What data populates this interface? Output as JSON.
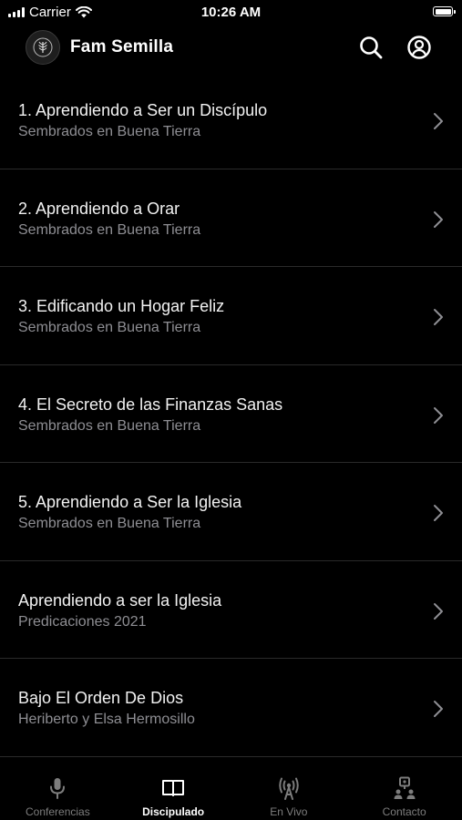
{
  "status_bar": {
    "carrier": "Carrier",
    "time": "10:26 AM"
  },
  "header": {
    "title": "Fam Semilla",
    "logo_icon": "wheat-seal-icon",
    "search_icon": "search-icon",
    "profile_icon": "profile-circle-icon"
  },
  "items": [
    {
      "title": "1. Aprendiendo a Ser un Discípulo",
      "subtitle": "Sembrados en Buena Tierra"
    },
    {
      "title": "2. Aprendiendo a Orar",
      "subtitle": "Sembrados en Buena Tierra"
    },
    {
      "title": "3. Edificando un Hogar Feliz",
      "subtitle": "Sembrados en Buena Tierra"
    },
    {
      "title": "4. El Secreto de las Finanzas Sanas",
      "subtitle": "Sembrados en Buena Tierra"
    },
    {
      "title": "5. Aprendiendo a Ser la Iglesia",
      "subtitle": "Sembrados en Buena Tierra"
    },
    {
      "title": "Aprendiendo a ser la Iglesia",
      "subtitle": "Predicaciones 2021"
    },
    {
      "title": "Bajo El Orden De Dios",
      "subtitle": "Heriberto y Elsa Hermosillo"
    }
  ],
  "tabs": [
    {
      "label": "Conferencias",
      "icon": "microphone-icon",
      "active": false
    },
    {
      "label": "Discipulado",
      "icon": "book-icon",
      "active": true
    },
    {
      "label": "En Vivo",
      "icon": "broadcast-icon",
      "active": false
    },
    {
      "label": "Contacto",
      "icon": "contact-icon",
      "active": false
    }
  ],
  "colors": {
    "background": "#000000",
    "text": "#ffffff",
    "subtitle": "#8e8e93",
    "inactive_tab": "#7d7d7d"
  }
}
